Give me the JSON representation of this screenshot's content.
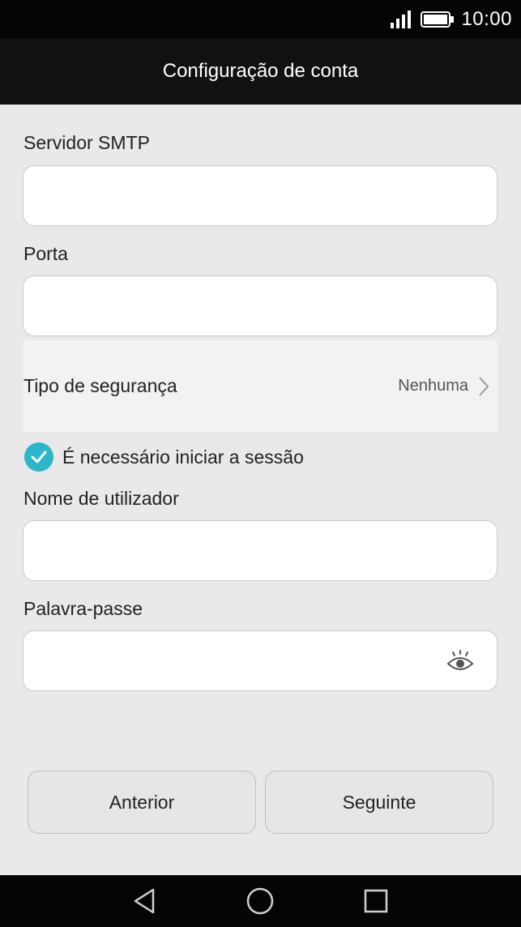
{
  "status_bar": {
    "time": "10:00",
    "icons": [
      "signal-icon",
      "battery-icon"
    ]
  },
  "header": {
    "title": "Configuração de conta"
  },
  "form": {
    "smtp_server": {
      "label": "Servidor SMTP",
      "value": ""
    },
    "port": {
      "label": "Porta",
      "value": ""
    },
    "security_type": {
      "label": "Tipo de segurança",
      "value": "Nenhuma"
    },
    "login_required": {
      "label": "É necessário iniciar a sessão",
      "checked": true
    },
    "username": {
      "label": "Nome de utilizador",
      "value": ""
    },
    "password": {
      "label": "Palavra-passe",
      "value": ""
    }
  },
  "buttons": {
    "previous_label": "Anterior",
    "next_label": "Seguinte"
  },
  "nav_bar": {
    "icons": [
      "back-icon",
      "home-icon",
      "recents-icon"
    ]
  },
  "colors": {
    "accent": "#2bb6c9",
    "background": "#e9e9e9",
    "header": "#111111"
  }
}
